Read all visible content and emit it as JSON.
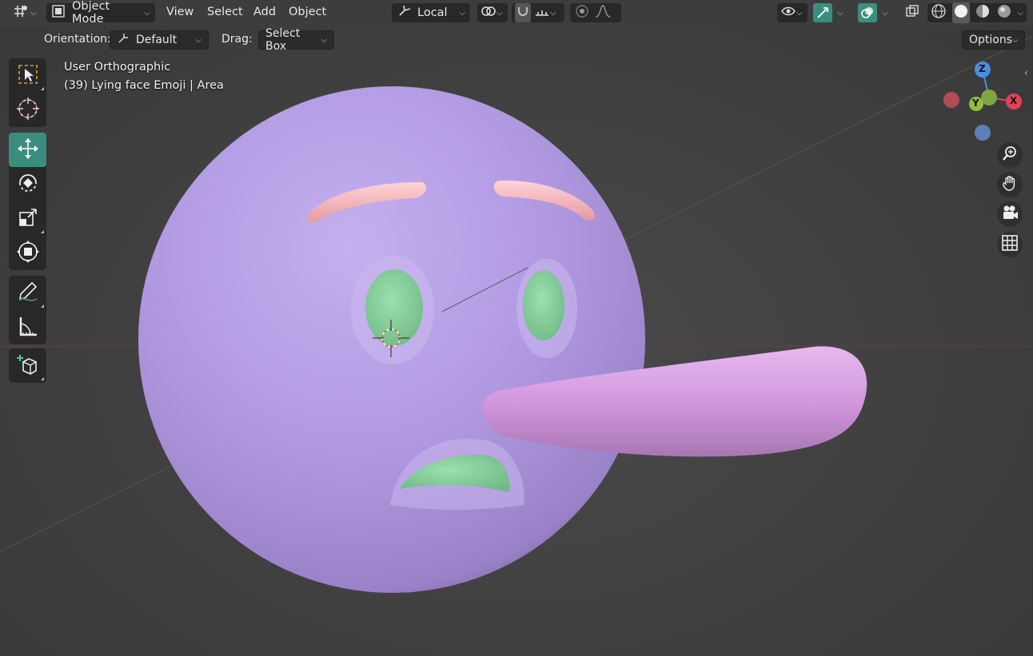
{
  "header": {
    "mode_label": "Object Mode",
    "menus": [
      "View",
      "Select",
      "Add",
      "Object"
    ],
    "transform_pivot_label": "Local",
    "options_label": "Options"
  },
  "tool_header": {
    "orientation_label": "Orientation:",
    "orientation_value": "Default",
    "drag_label": "Drag:",
    "drag_value": "Select Box"
  },
  "viewport": {
    "view_name": "User Orthographic",
    "object_info": "(39) Lying face Emoji | Area"
  },
  "gizmo": {
    "axes": [
      "Z",
      "Y",
      "X"
    ],
    "colors": {
      "x": "#e04454",
      "y": "#8fbf3a",
      "z": "#4a8ee0"
    }
  },
  "toolbar": {
    "tools": [
      "select-box",
      "cursor",
      "move",
      "rotate",
      "scale",
      "transform",
      "annotate",
      "measure",
      "add-cube"
    ],
    "active": "move"
  },
  "navigation": [
    "zoom",
    "pan",
    "camera",
    "perspective-toggle"
  ],
  "colors": {
    "accent": "#3b8e7e",
    "face": "#b7a0e6",
    "brows": "#f2b3b8",
    "eyes_mouth": "#8fd4a3",
    "nose": "#d09de0"
  }
}
